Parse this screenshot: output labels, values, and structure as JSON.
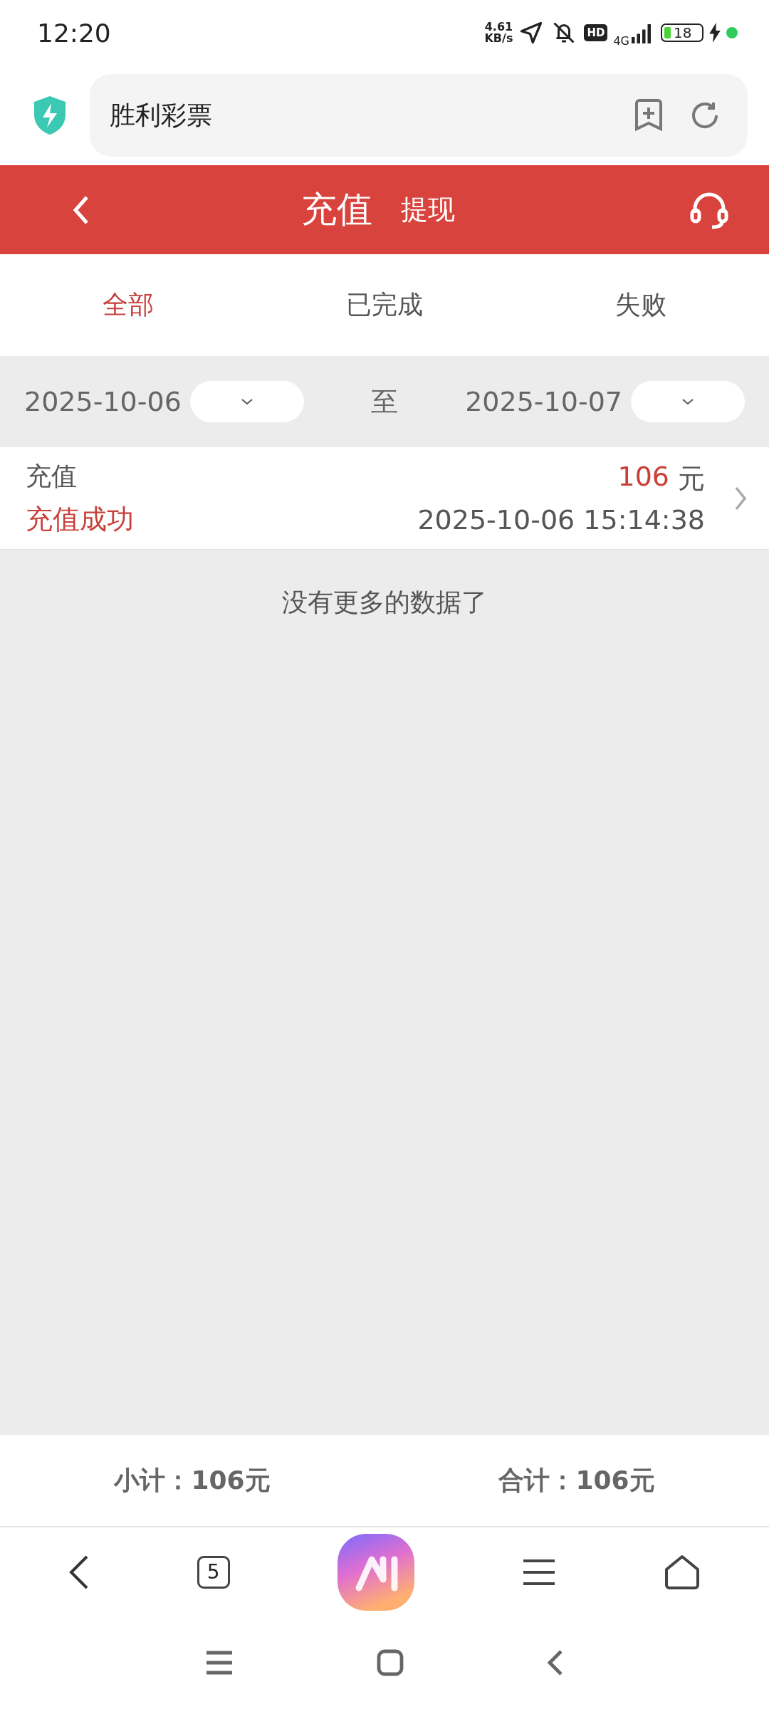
{
  "status_bar": {
    "time": "12:20",
    "net_speed_value": "4.61",
    "net_speed_unit": "KB/s",
    "hd_badge": "HD",
    "network": "4G",
    "battery": "18"
  },
  "address_bar": {
    "title": "胜利彩票"
  },
  "header": {
    "tabs": [
      {
        "label": "充值",
        "selected": true
      },
      {
        "label": "提现",
        "selected": false
      }
    ]
  },
  "filter_tabs": [
    {
      "label": "全部",
      "selected": true
    },
    {
      "label": "已完成",
      "selected": false
    },
    {
      "label": "失败",
      "selected": false
    }
  ],
  "date_range": {
    "start": "2025-10-06",
    "separator": "至",
    "end": "2025-10-07"
  },
  "records": [
    {
      "type": "充值",
      "status": "充值成功",
      "amount": "106",
      "unit": "元",
      "time": "2025-10-06 15:14:38"
    }
  ],
  "empty_message": "没有更多的数据了",
  "summary": {
    "subtotal": "小计：106元",
    "total": "合计：106元"
  },
  "browser_toolbar": {
    "tab_count": "5"
  }
}
